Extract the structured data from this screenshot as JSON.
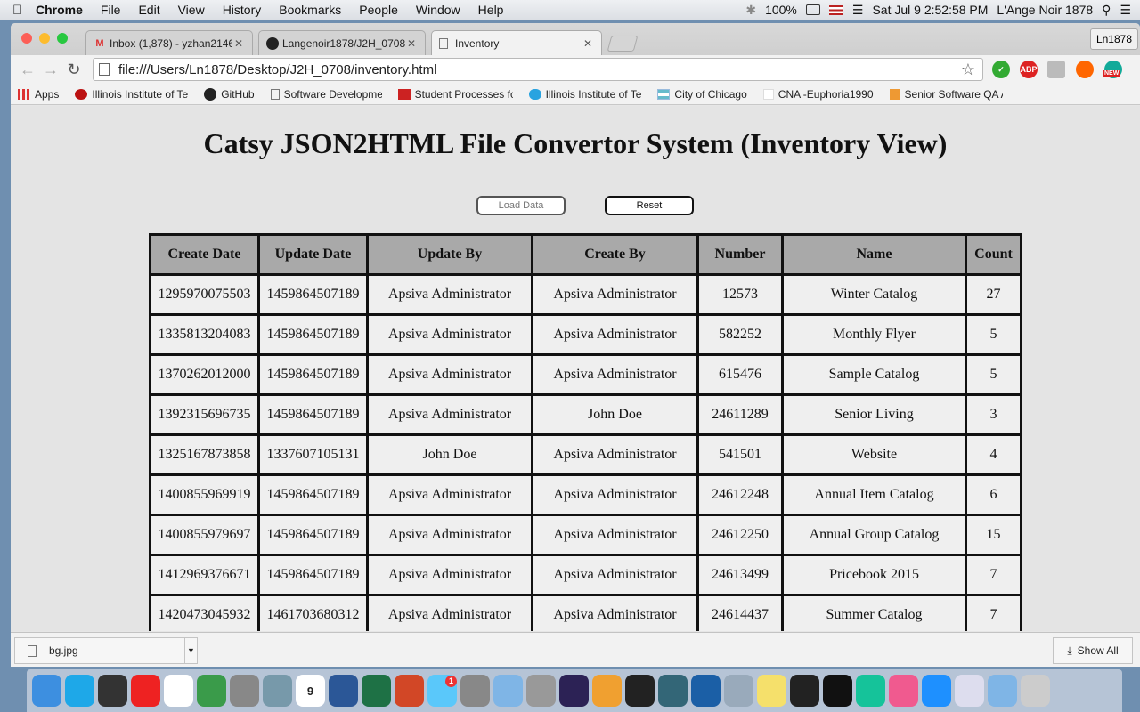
{
  "menubar": {
    "app_name": "Chrome",
    "items": [
      "File",
      "Edit",
      "View",
      "History",
      "Bookmarks",
      "People",
      "Window",
      "Help"
    ],
    "battery": "100%",
    "datetime": "Sat Jul 9  2:52:58 PM",
    "user": "L'Ange Noir 1878"
  },
  "tabs": [
    {
      "label": "Inbox (1,878) - yzhan2146",
      "icon": "gmail-icon"
    },
    {
      "label": "Langenoir1878/J2H_0708",
      "icon": "github-icon"
    },
    {
      "label": "Inventory",
      "icon": "page-icon"
    }
  ],
  "profile_label": "Ln1878",
  "address": "file:///Users/Ln1878/Desktop/J2H_0708/inventory.html",
  "extensions": {
    "abp": "ABP",
    "new_badge": "NEW"
  },
  "bookmarks": [
    {
      "label": "Apps"
    },
    {
      "label": "Illinois Institute of Te"
    },
    {
      "label": "GitHub"
    },
    {
      "label": "Software Developme"
    },
    {
      "label": "Student Processes fo"
    },
    {
      "label": "Illinois Institute of Te"
    },
    {
      "label": "City of Chicago"
    },
    {
      "label": "CNA -Euphoria1990"
    },
    {
      "label": "Senior Software QA A"
    }
  ],
  "page": {
    "title": "Catsy JSON2HTML File Convertor System (Inventory View)",
    "load_button": "Load Data",
    "reset_button": "Reset"
  },
  "table": {
    "headers": [
      "Create Date",
      "Update Date",
      "Update By",
      "Create By",
      "Number",
      "Name",
      "Count"
    ],
    "rows": [
      [
        "1295970075503",
        "1459864507189",
        "Apsiva Administrator",
        "Apsiva Administrator",
        "12573",
        "Winter Catalog",
        "27"
      ],
      [
        "1335813204083",
        "1459864507189",
        "Apsiva Administrator",
        "Apsiva Administrator",
        "582252",
        "Monthly Flyer",
        "5"
      ],
      [
        "1370262012000",
        "1459864507189",
        "Apsiva Administrator",
        "Apsiva Administrator",
        "615476",
        "Sample Catalog",
        "5"
      ],
      [
        "1392315696735",
        "1459864507189",
        "Apsiva Administrator",
        "John Doe",
        "24611289",
        "Senior Living",
        "3"
      ],
      [
        "1325167873858",
        "1337607105131",
        "John Doe",
        "Apsiva Administrator",
        "541501",
        "Website",
        "4"
      ],
      [
        "1400855969919",
        "1459864507189",
        "Apsiva Administrator",
        "Apsiva Administrator",
        "24612248",
        "Annual Item Catalog",
        "6"
      ],
      [
        "1400855979697",
        "1459864507189",
        "Apsiva Administrator",
        "Apsiva Administrator",
        "24612250",
        "Annual Group Catalog",
        "15"
      ],
      [
        "1412969376671",
        "1459864507189",
        "Apsiva Administrator",
        "Apsiva Administrator",
        "24613499",
        "Pricebook 2015",
        "7"
      ],
      [
        "1420473045932",
        "1461703680312",
        "Apsiva Administrator",
        "Apsiva Administrator",
        "24614437",
        "Summer Catalog",
        "7"
      ]
    ]
  },
  "downloads": {
    "file": "bg.jpg",
    "show_all": "Show All"
  },
  "dock": {
    "calendar_day": "9",
    "messages_badge": "1",
    "apps": [
      "finder-icon",
      "skype-icon",
      "dashboard-icon",
      "youtube-icon",
      "chrome-icon",
      "drive-icon",
      "calculator-icon",
      "preview-icon",
      "calendar-icon",
      "word-icon",
      "excel-icon",
      "powerpoint-icon",
      "messages-icon",
      "system-preferences-icon",
      "virtualbox-icon",
      "database-icon",
      "eclipse-icon",
      "sublime-icon",
      "terminal-icon",
      "mysql-workbench-icon",
      "quicktime-icon",
      "app-store-icon",
      "stickies-icon",
      "printer-icon",
      "qq-icon",
      "grammarly-icon",
      "itunes-icon",
      "safari-icon",
      "documents-icon",
      "virtualbox-stack-icon",
      "trash-icon"
    ]
  }
}
